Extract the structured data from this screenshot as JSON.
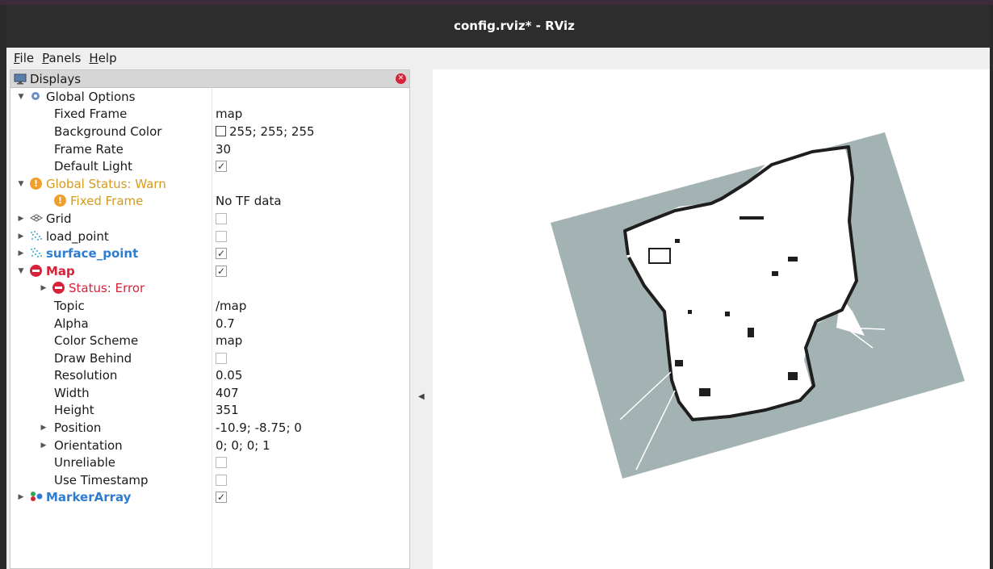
{
  "window": {
    "title": "config.rviz* - RViz"
  },
  "menu": [
    {
      "label": "File",
      "accel": "F",
      "rest": "ile"
    },
    {
      "label": "Panels",
      "accel": "P",
      "rest": "anels"
    },
    {
      "label": "Help",
      "accel": "H",
      "rest": "elp"
    }
  ],
  "displays_panel": {
    "title": "Displays",
    "global_options": {
      "label": "Global Options",
      "fixed_frame": {
        "label": "Fixed Frame",
        "value": "map"
      },
      "background_color": {
        "label": "Background Color",
        "value": "255; 255; 255"
      },
      "frame_rate": {
        "label": "Frame Rate",
        "value": "30"
      },
      "default_light": {
        "label": "Default Light",
        "checked": true
      }
    },
    "global_status": {
      "label": "Global Status: Warn",
      "fixed_frame": {
        "label": "Fixed Frame",
        "value": "No TF data"
      }
    },
    "grid": {
      "label": "Grid",
      "checked": false
    },
    "load_point": {
      "label": "load_point",
      "checked": false
    },
    "surface_point": {
      "label": "surface_point",
      "checked": true
    },
    "map": {
      "label": "Map",
      "checked": true,
      "status": {
        "label": "Status: Error"
      },
      "topic": {
        "label": "Topic",
        "value": "/map"
      },
      "alpha": {
        "label": "Alpha",
        "value": "0.7"
      },
      "color_scheme": {
        "label": "Color Scheme",
        "value": "map"
      },
      "draw_behind": {
        "label": "Draw Behind",
        "checked": false
      },
      "resolution": {
        "label": "Resolution",
        "value": "0.05"
      },
      "width": {
        "label": "Width",
        "value": "407"
      },
      "height": {
        "label": "Height",
        "value": "351"
      },
      "position": {
        "label": "Position",
        "value": "-10.9; -8.75; 0"
      },
      "orientation": {
        "label": "Orientation",
        "value": "0; 0; 0; 1"
      },
      "unreliable": {
        "label": "Unreliable",
        "checked": false
      },
      "use_timestamp": {
        "label": "Use Timestamp",
        "checked": false
      }
    },
    "marker_array": {
      "label": "MarkerArray",
      "checked": true
    }
  },
  "colors": {
    "warn": "#d69a1a",
    "error": "#d6233a",
    "link_blue": "#2e7cd1",
    "map_background": "#a3b2b2"
  }
}
